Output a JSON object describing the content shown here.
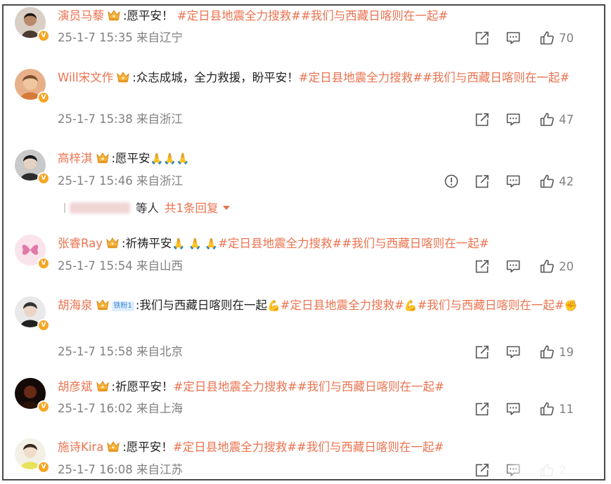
{
  "colors": {
    "accent": "#eb7350",
    "meta": "#808080",
    "badge": "#f6a623"
  },
  "comments": [
    {
      "user": "演员马藜",
      "text": ":愿平安！",
      "topics": "#定日县地震全力搜救##我们与西藏日喀则在一起#",
      "time": "25-1-7 15:35",
      "location": "来自辽宁",
      "likes": "70",
      "report": false
    },
    {
      "user": "Will宋文作",
      "text": ":众志成城，全力救援，盼平安！",
      "topics": "#定日县地震全力搜救##我们与西藏日喀则在一起#",
      "time": "25-1-7 15:38",
      "location": "来自浙江",
      "likes": "47",
      "report": false
    },
    {
      "user": "高梓淇",
      "text": ":愿平安",
      "emoji": "🙏🙏🙏",
      "topics": "",
      "time": "25-1-7 15:46",
      "location": "来自浙江",
      "likes": "42",
      "report": true,
      "reply": {
        "suffix": "等人",
        "more": "共1条回复"
      }
    },
    {
      "user": "张睿Ray",
      "text": ":祈祷平安",
      "emoji": "🙏 🙏 🙏",
      "topics": "#定日县地震全力搜救##我们与西藏日喀则在一起#",
      "time": "25-1-7 15:54",
      "location": "来自山西",
      "likes": "20",
      "report": false
    },
    {
      "user": "胡海泉",
      "fan_badge": "铁粉1",
      "text": ":我们与西藏日喀则在一起",
      "emoji": "💪",
      "topics": "#定日县地震全力搜救#",
      "emoji2": "💪",
      "topics2": "#我们与西藏日喀则在一起#",
      "emoji3": "✊",
      "time": "25-1-7 15:58",
      "location": "来自北京",
      "likes": "19",
      "report": false
    },
    {
      "user": "胡彦斌",
      "text": ":祈愿平安！",
      "topics": "#定日县地震全力搜救##我们与西藏日喀则在一起#",
      "time": "25-1-7 16:02",
      "location": "来自上海",
      "likes": "11",
      "report": false
    },
    {
      "user": "施诗Kira",
      "text": ":愿平安！",
      "topics": "#定日县地震全力搜救##我们与西藏日喀则在一起#",
      "time": "25-1-7 16:08",
      "location": "来自江苏",
      "likes": "2",
      "report": false
    }
  ],
  "icons": {
    "share": "share-icon",
    "comment": "comment-icon",
    "like": "thumbs-up-icon",
    "report": "alert-icon",
    "crown": "crown-icon",
    "verified": "verified-v-icon"
  }
}
